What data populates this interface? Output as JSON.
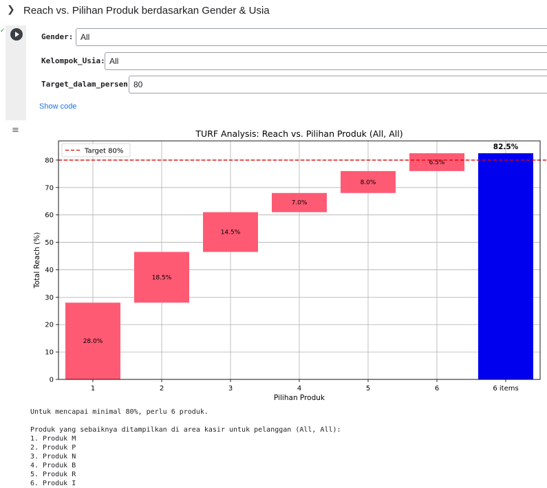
{
  "section": {
    "title": "Reach vs. Pilihan Produk berdasarkan Gender & Usia"
  },
  "form": {
    "gender_label": "Gender:",
    "gender_value": "All",
    "usia_label": "Kelompok_Usia:",
    "usia_value": "All",
    "target_label": "Target_dalam_persen:",
    "target_value": "80",
    "show_code": "Show code"
  },
  "chart_data": {
    "type": "bar",
    "title": "TURF Analysis: Reach vs. Pilihan Produk (All, All)",
    "xlabel": "Pilihan Produk",
    "ylabel": "Total Reach (%)",
    "categories": [
      "1",
      "2",
      "3",
      "4",
      "5",
      "6",
      "6 items"
    ],
    "increments": [
      28.0,
      18.5,
      14.5,
      7.0,
      8.0,
      6.5
    ],
    "increment_labels": [
      "28.0%",
      "18.5%",
      "14.5%",
      "7.0%",
      "8.0%",
      "6.5%"
    ],
    "total": 82.5,
    "total_label": "82.5%",
    "target": 80,
    "target_legend": "Target 80%",
    "yticks": [
      "0",
      "10",
      "20",
      "30",
      "40",
      "50",
      "60",
      "70",
      "80"
    ],
    "ylim": [
      0,
      87
    ],
    "grid": true,
    "legend_position": "top-left",
    "colors": {
      "increment": "#ff5a73",
      "total": "#0000ee",
      "target": "#e00000"
    }
  },
  "console": {
    "lines": [
      "Untuk mencapai minimal 80%, perlu 6 produk.",
      "",
      "Produk yang sebaiknya ditampilkan di area kasir untuk pelanggan (All, All):",
      "1. Produk M",
      "2. Produk P",
      "3. Produk N",
      "4. Produk B",
      "5. Produk R",
      "6. Produk I"
    ]
  }
}
